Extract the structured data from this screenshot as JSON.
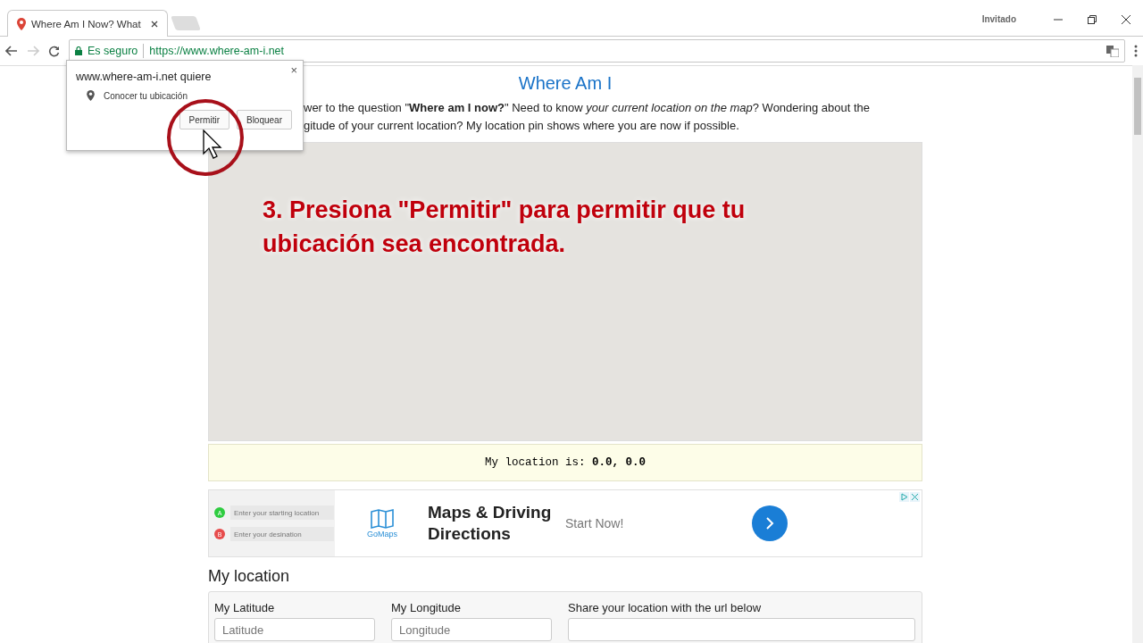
{
  "browser": {
    "tabs": [
      {
        "title": "Where Am I Now? What",
        "selected": true
      }
    ],
    "profile": "Invitado",
    "security": "Es seguro",
    "url": "https://www.where-am-i.net"
  },
  "permission_popup": {
    "title": "www.where-am-i.net quiere",
    "permission": "Conocer tu ubicación",
    "buttons": [
      "Permitir",
      "Bloquear"
    ],
    "close": "×"
  },
  "page": {
    "title": "Where Am I",
    "intro_lines": [
      "wer to the question \"**Where am I now?**\" Need to know *your current location on the map*? Wondering about the",
      "gitude of your current location? My location pin shows where you are now if possible."
    ],
    "annotation": "3. Presiona \"Permitir\" para permitir que tu ubicación sea encontrada.",
    "location_readout": "My location is: **0.0, 0.0**",
    "ad": {
      "start_placeholder": "Enter your starting location",
      "destination_placeholder": "Enter your desination",
      "marker_a": "A",
      "marker_b": "B",
      "brand": "GoMaps",
      "headline": "Maps & Driving Directions",
      "cta": "Start Now!"
    },
    "section_title": "My location",
    "fields": [
      {
        "label": "My Latitude",
        "placeholder": "Latitude"
      },
      {
        "label": "My Longitude",
        "placeholder": "Longitude"
      },
      {
        "label": "Share your location with the url below"
      }
    ]
  }
}
